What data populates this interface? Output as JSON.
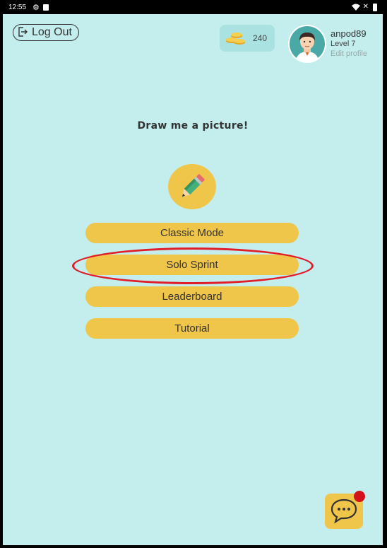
{
  "statusbar": {
    "time": "12:55"
  },
  "header": {
    "logout_label": "Log Out",
    "coins": "240",
    "username": "anpod89",
    "level": "Level 7",
    "edit_profile": "Edit profile"
  },
  "main": {
    "title": "Draw me a picture!",
    "menu": [
      {
        "label": "Classic Mode"
      },
      {
        "label": "Solo Sprint"
      },
      {
        "label": "Leaderboard"
      },
      {
        "label": "Tutorial"
      }
    ]
  },
  "colors": {
    "background": "#c3eeed",
    "button": "#efc54a",
    "highlight": "#e11d2a",
    "notification": "#d3121c"
  },
  "icons": [
    "settings-gear-icon",
    "sd-card-icon",
    "wifi-icon",
    "battery-icon",
    "logout-icon",
    "coins-icon",
    "pencil-icon",
    "chat-icon"
  ]
}
